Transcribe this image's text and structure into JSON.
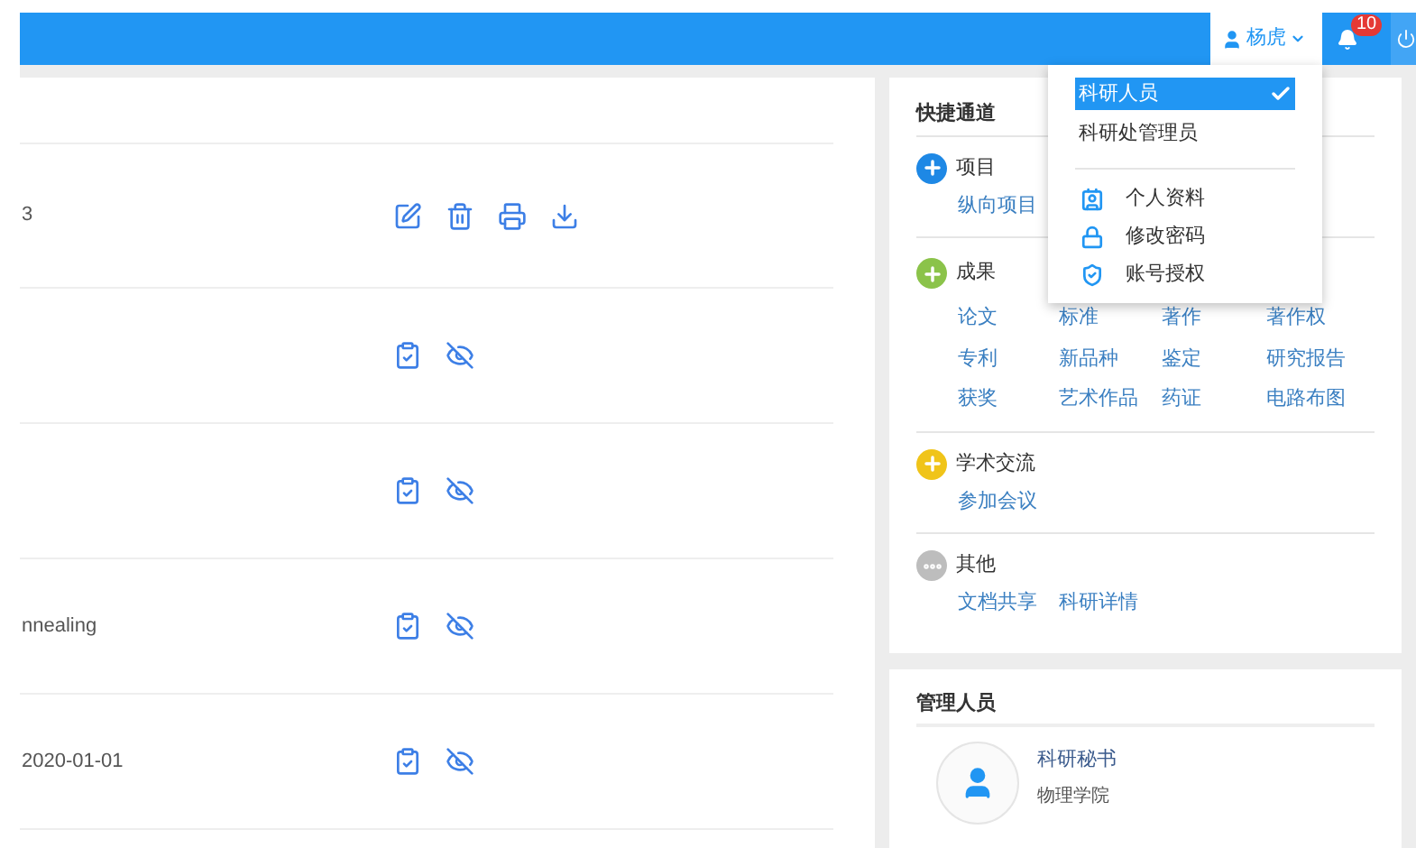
{
  "header": {
    "user": "杨虎",
    "notifications": "10"
  },
  "user_menu": {
    "roles": [
      {
        "label": "科研人员",
        "selected": true
      },
      {
        "label": "科研处管理员",
        "selected": false
      }
    ],
    "items": [
      {
        "label": "个人资料",
        "kind": "profile"
      },
      {
        "label": "修改密码",
        "kind": "lock"
      },
      {
        "label": "账号授权",
        "kind": "shield"
      }
    ]
  },
  "rows": [
    {
      "text": "3",
      "actions": [
        {
          "kind": "edit"
        },
        {
          "kind": "delete"
        },
        {
          "kind": "print"
        },
        {
          "kind": "download"
        }
      ]
    },
    {
      "actions": [
        {
          "kind": "approve"
        },
        {
          "kind": "hide"
        }
      ]
    },
    {
      "actions": [
        {
          "kind": "approve"
        },
        {
          "kind": "hide"
        }
      ]
    },
    {
      "text": "nnealing",
      "actions": [
        {
          "kind": "approve"
        },
        {
          "kind": "hide"
        }
      ]
    },
    {
      "text": "2020-01-01",
      "actions": [
        {
          "kind": "approve"
        },
        {
          "kind": "hide"
        }
      ]
    }
  ],
  "quick_access": {
    "title": "快捷通道",
    "sections": [
      {
        "title": "项目",
        "kind": "add",
        "color": "#1e88e5",
        "links": [
          "纵向项目"
        ]
      },
      {
        "title": "成果",
        "kind": "add",
        "color": "#8bc34a",
        "links": [
          "论文",
          "标准",
          "著作",
          "著作权",
          "专利",
          "新品种",
          "鉴定",
          "研究报告",
          "获奖",
          "艺术作品",
          "药证",
          "电路布图"
        ]
      },
      {
        "title": "学术交流",
        "kind": "add",
        "color": "#f0c419",
        "links": [
          "参加会议"
        ]
      },
      {
        "title": "其他",
        "kind": "more",
        "color": "#bdbdbd",
        "links": [
          "文档共享",
          "科研详情"
        ]
      }
    ]
  },
  "admins": {
    "title": "管理人员",
    "person": {
      "name": "科研秘书",
      "unit": "物理学院"
    }
  }
}
